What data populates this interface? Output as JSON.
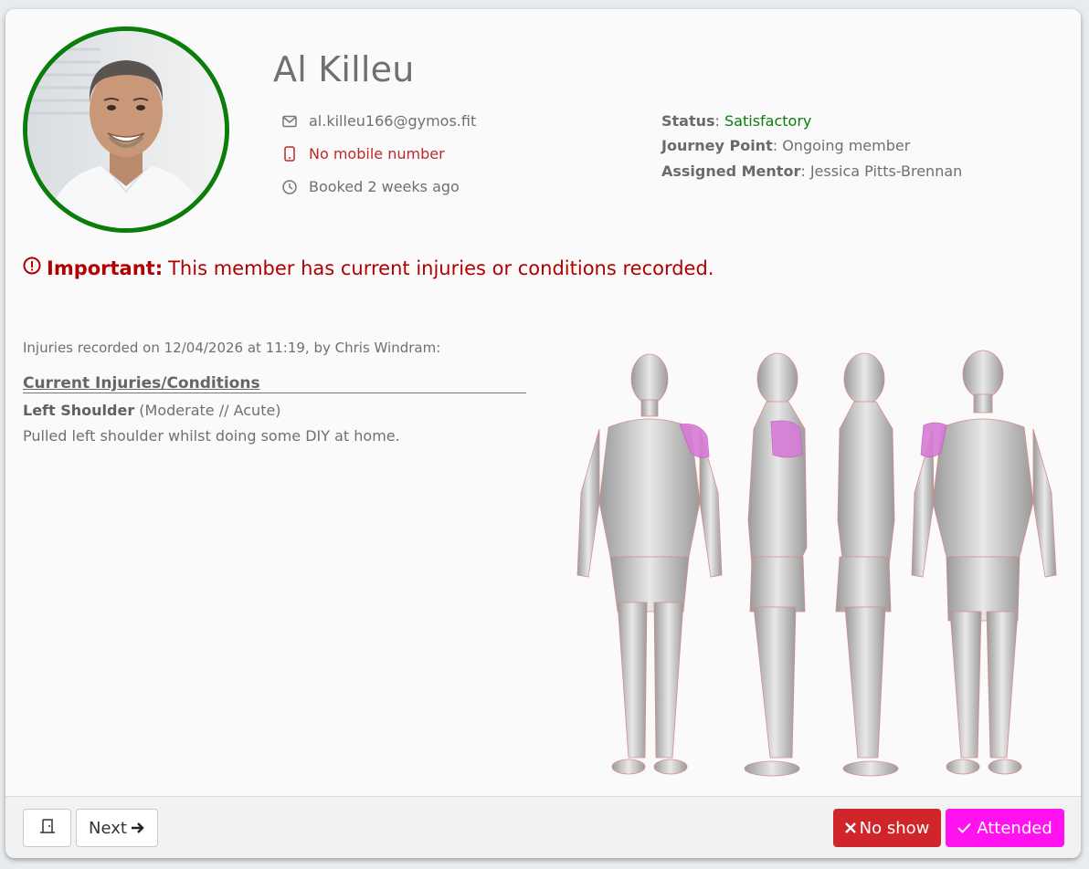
{
  "member": {
    "name": "Al Killeu",
    "email": "al.killeu166@gymos.fit",
    "mobile": "No mobile number",
    "booked": "Booked 2 weeks ago",
    "avatar_ring_color": "#0a7d0a"
  },
  "meta": {
    "status_label": "Status",
    "status_value": "Satisfactory",
    "journey_label": "Journey Point",
    "journey_value": "Ongoing member",
    "mentor_label": "Assigned Mentor",
    "mentor_value": "Jessica Pitts-Brennan"
  },
  "alert": {
    "title": "Important:",
    "message": "This member has current injuries or conditions recorded."
  },
  "injuries": {
    "recorded": "Injuries recorded on 12/04/2026 at 11:19, by Chris Windram:",
    "heading": "Current Injuries/Conditions",
    "items": [
      {
        "name": "Left Shoulder",
        "detail": "(Moderate // Acute)",
        "description": "Pulled left shoulder whilst doing some DIY at home."
      }
    ],
    "highlight_color": "#d77ad6"
  },
  "footer": {
    "next_label": "Next",
    "noshow_label": "No show",
    "attended_label": "Attended"
  },
  "icons": {
    "email": "envelope-icon",
    "mobile": "mobile-phone-icon",
    "booked": "clock-icon",
    "alert": "exclamation-circle-icon",
    "door": "door-icon",
    "next": "arrow-right-icon",
    "noshow": "x-icon",
    "attended": "check-icon"
  }
}
